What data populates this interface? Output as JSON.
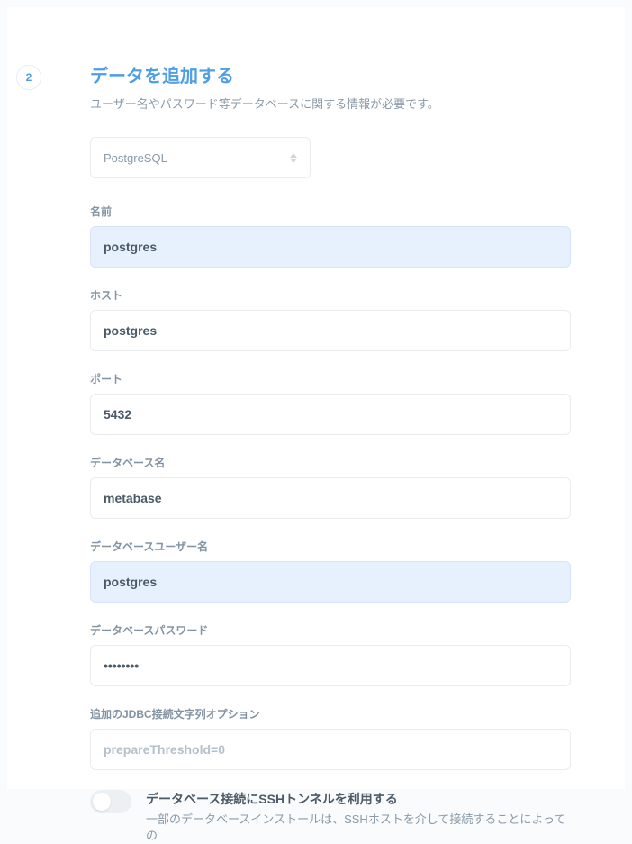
{
  "step": "2",
  "title": "データを追加する",
  "subtitle": "ユーザー名やパスワード等データベースに関する情報が必要です。",
  "db_type": {
    "selected": "PostgreSQL"
  },
  "fields": {
    "name": {
      "label": "名前",
      "value": "postgres"
    },
    "host": {
      "label": "ホスト",
      "value": "postgres"
    },
    "port": {
      "label": "ポート",
      "value": "5432"
    },
    "dbname": {
      "label": "データベース名",
      "value": "metabase"
    },
    "user": {
      "label": "データベースユーザー名",
      "value": "postgres"
    },
    "password": {
      "label": "データベースパスワード",
      "value": "••••••••"
    },
    "jdbc": {
      "label": "追加のJDBC接続文字列オプション",
      "placeholder": "prepareThreshold=0"
    }
  },
  "ssh_toggle": {
    "title": "データベース接続にSSHトンネルを利用する",
    "desc": "一部のデータベースインストールは、SSHホストを介して接続することによっての"
  }
}
